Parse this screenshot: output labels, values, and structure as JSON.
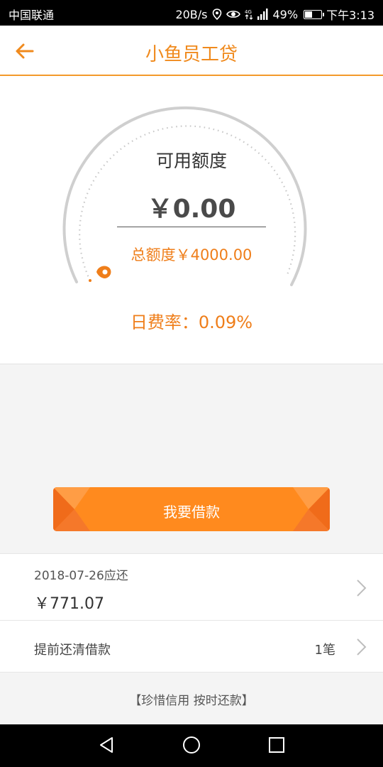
{
  "status_bar": {
    "carrier": "中国联通",
    "speed": "20B/s",
    "battery": "49%",
    "battery_level": 0.49,
    "time": "下午3:13",
    "icons": [
      "location-icon",
      "eye-icon",
      "4g-icon",
      "signal-icon",
      "battery-icon"
    ]
  },
  "header": {
    "title": "小鱼员工贷",
    "back_icon": "back-arrow-icon"
  },
  "credit": {
    "available_label": "可用额度",
    "available_amount": "￥0.00",
    "total": "总额度￥4000.00",
    "rate": "日费率：0.09%",
    "usage_fraction": 0
  },
  "actions": {
    "borrow_label": "我要借款"
  },
  "repayment": {
    "due_date_text": "2018-07-26应还",
    "due_amount": "￥771.07"
  },
  "prepay": {
    "label": "提前还清借款",
    "count": "1笔"
  },
  "slogan": "【珍惜信用  按时还款】",
  "colors": {
    "accent": "#f08a1d",
    "button": "#ff8a1e"
  }
}
